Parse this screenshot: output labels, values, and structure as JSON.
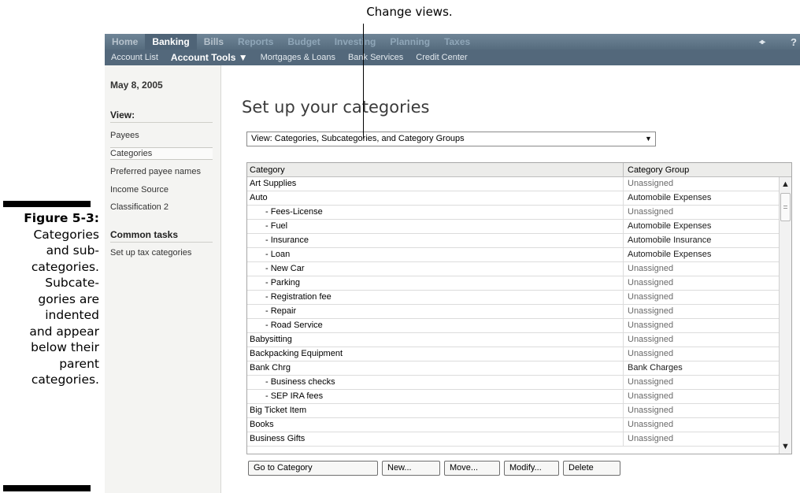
{
  "annotation": {
    "callout": "Change views.",
    "figure_label": "Figure 5-3:",
    "caption_lines": [
      "Categories",
      "and sub-",
      "categories.",
      "Subcate-",
      "gories are",
      "indented",
      "and appear",
      "below their",
      "parent",
      "categories."
    ]
  },
  "nav": {
    "main_tabs": [
      {
        "label": "Home",
        "state": "normal"
      },
      {
        "label": "Banking",
        "state": "active"
      },
      {
        "label": "Bills",
        "state": "normal"
      },
      {
        "label": "Reports",
        "state": "faded"
      },
      {
        "label": "Budget",
        "state": "faded"
      },
      {
        "label": "Investing",
        "state": "faded"
      },
      {
        "label": "Planning",
        "state": "faded"
      },
      {
        "label": "Taxes",
        "state": "faded"
      }
    ],
    "help_icon": "?",
    "swap_icon": "switch-arrows-icon",
    "sub_items": [
      {
        "label": "Account List"
      },
      {
        "label": "Account Tools ▼",
        "bold": true
      },
      {
        "label": "Mortgages & Loans"
      },
      {
        "label": "Bank Services"
      },
      {
        "label": "Credit Center"
      }
    ]
  },
  "sidebar": {
    "date": "May 8, 2005",
    "view_heading": "View:",
    "view_items": [
      {
        "label": "Payees",
        "selected": false
      },
      {
        "label": "Categories",
        "selected": true
      },
      {
        "label": "Preferred payee names",
        "selected": false
      },
      {
        "label": "Income Source",
        "selected": false
      },
      {
        "label": "Classification 2",
        "selected": false
      }
    ],
    "tasks_heading": "Common tasks",
    "task_items": [
      {
        "label": "Set up tax categories"
      }
    ]
  },
  "main": {
    "title": "Set up your categories",
    "view_select": {
      "value": "View: Categories, Subcategories, and Category Groups"
    },
    "columns": {
      "category": "Category",
      "group": "Category Group"
    },
    "rows": [
      {
        "category": "Art Supplies",
        "group": "Unassigned",
        "sub": false
      },
      {
        "category": "Auto",
        "group": "Automobile Expenses",
        "sub": false
      },
      {
        "category": "- Fees-License",
        "group": "Unassigned",
        "sub": true
      },
      {
        "category": "- Fuel",
        "group": "Automobile Expenses",
        "sub": true
      },
      {
        "category": "- Insurance",
        "group": "Automobile Insurance",
        "sub": true
      },
      {
        "category": "- Loan",
        "group": "Automobile Expenses",
        "sub": true
      },
      {
        "category": "- New Car",
        "group": "Unassigned",
        "sub": true
      },
      {
        "category": "- Parking",
        "group": "Unassigned",
        "sub": true
      },
      {
        "category": "- Registration fee",
        "group": "Unassigned",
        "sub": true
      },
      {
        "category": "- Repair",
        "group": "Unassigned",
        "sub": true
      },
      {
        "category": "- Road Service",
        "group": "Unassigned",
        "sub": true
      },
      {
        "category": "Babysitting",
        "group": "Unassigned",
        "sub": false
      },
      {
        "category": "Backpacking Equipment",
        "group": "Unassigned",
        "sub": false
      },
      {
        "category": "Bank Chrg",
        "group": "Bank Charges",
        "sub": false
      },
      {
        "category": "- Business checks",
        "group": "Unassigned",
        "sub": true
      },
      {
        "category": "- SEP IRA fees",
        "group": "Unassigned",
        "sub": true
      },
      {
        "category": "Big Ticket Item",
        "group": "Unassigned",
        "sub": false
      },
      {
        "category": "Books",
        "group": "Unassigned",
        "sub": false
      },
      {
        "category": "Business Gifts",
        "group": "Unassigned",
        "sub": false
      }
    ],
    "buttons": [
      {
        "label": "Go to Category",
        "name": "go-to-category-button"
      },
      {
        "label": "New...",
        "name": "new-button"
      },
      {
        "label": "Move...",
        "name": "move-button"
      },
      {
        "label": "Modify...",
        "name": "modify-button"
      },
      {
        "label": "Delete",
        "name": "delete-button"
      }
    ]
  }
}
